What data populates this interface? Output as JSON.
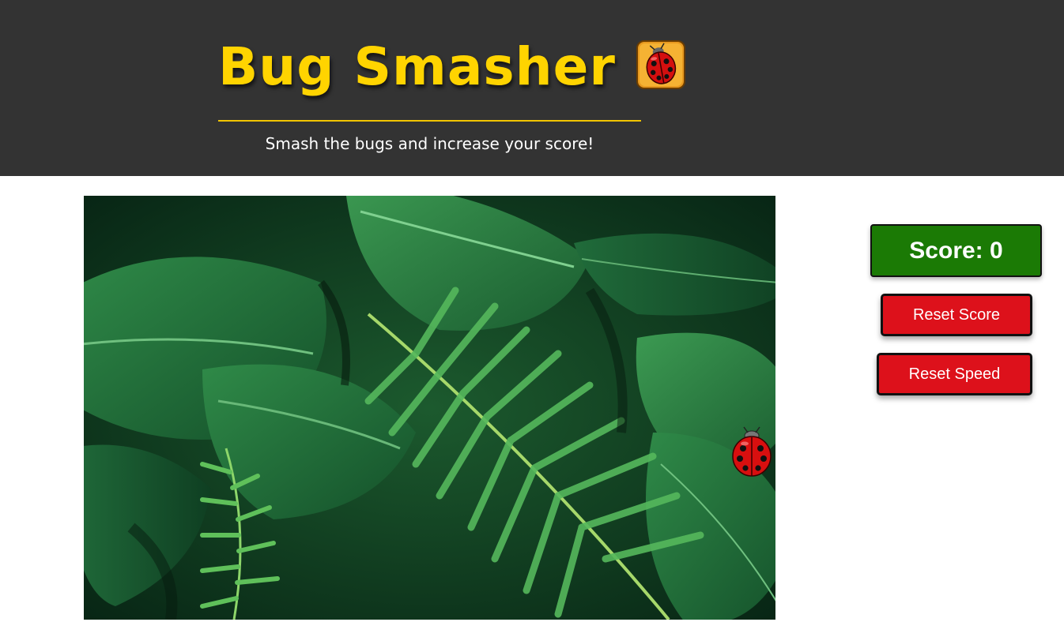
{
  "header": {
    "title": "Bug Smasher",
    "title_icon": "ladybug-icon",
    "subtitle": "Smash the bugs and increase your score!",
    "background_color": "#333333",
    "title_color": "#ffd400"
  },
  "game": {
    "background": "tropical-leaves-image",
    "bug_icon": "ladybug-icon"
  },
  "sidebar": {
    "score_label": "Score: 0",
    "score_color": "#1b7a05",
    "reset_score_label": "Reset Score",
    "reset_speed_label": "Reset Speed",
    "button_color": "#dd111b"
  }
}
